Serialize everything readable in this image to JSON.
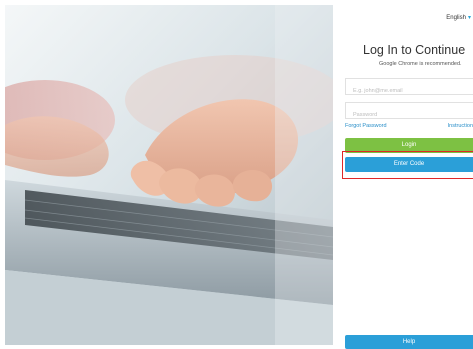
{
  "language": {
    "label": "English",
    "caret": "▾"
  },
  "login": {
    "title": "Log In to Continue",
    "subtitle": "Google Chrome is recommended.",
    "email_placeholder": "E.g. john@me.email",
    "password_placeholder": "Password",
    "forgot_password": "Forgot Password",
    "instructions": "Instruction",
    "login_button": "Login",
    "enter_code_button": "Enter Code",
    "help_button": "Help"
  },
  "colors": {
    "login_green": "#7dc143",
    "button_blue": "#2b9fd8",
    "link_blue": "#2a8fc9",
    "highlight_red": "#e02828"
  }
}
